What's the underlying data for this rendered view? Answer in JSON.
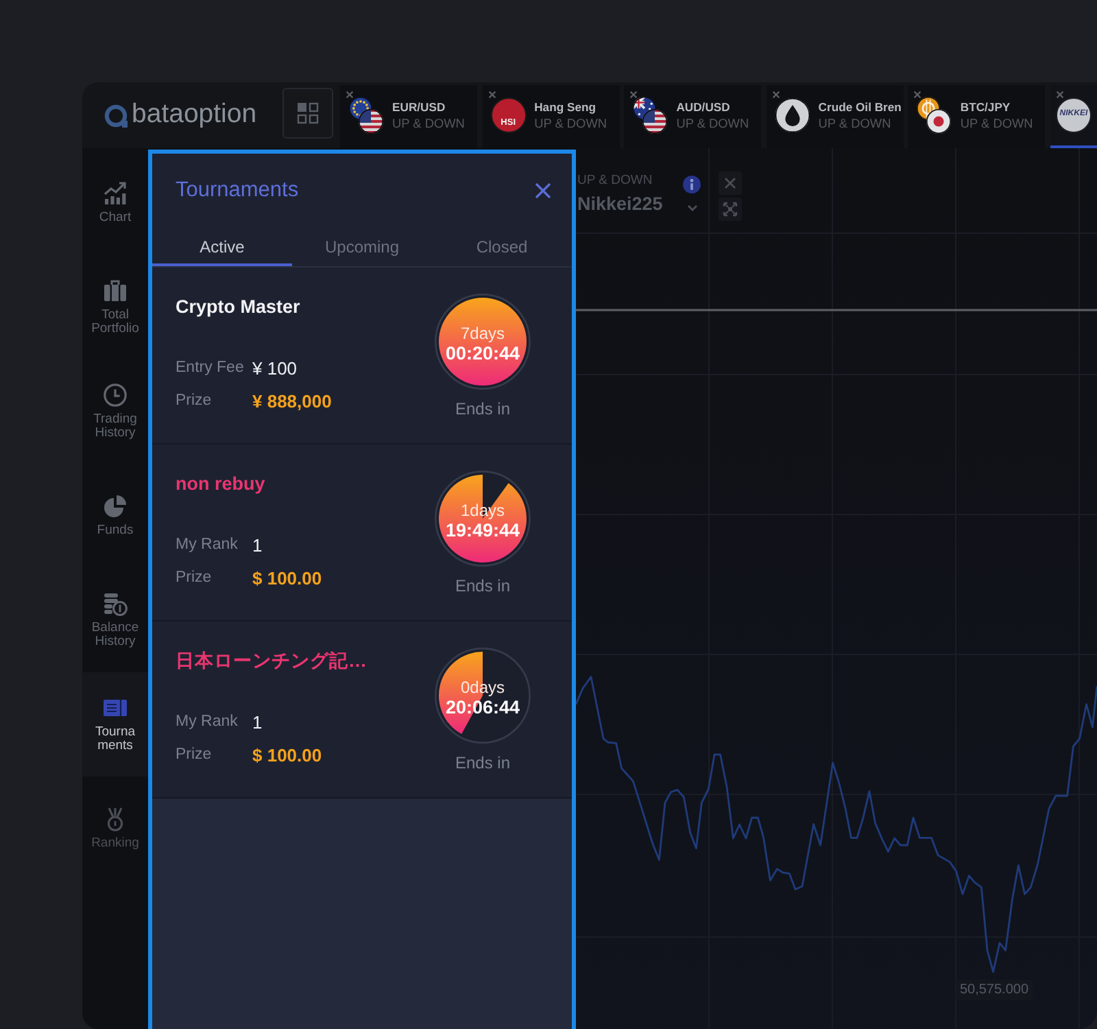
{
  "brand": {
    "name": "bataoption"
  },
  "asset_tabs": [
    {
      "name": "EUR/USD",
      "mode": "UP & DOWN",
      "selected": false
    },
    {
      "logo_text": "HSI",
      "name": "Hang Seng",
      "mode": "UP & DOWN",
      "selected": false
    },
    {
      "name": "AUD/USD",
      "mode": "UP & DOWN",
      "selected": false
    },
    {
      "name": "Crude Oil Bren",
      "mode": "UP & DOWN",
      "selected": false
    },
    {
      "name": "BTC/JPY",
      "mode": "UP & DOWN",
      "selected": false
    },
    {
      "logo_text": "NIKKEI",
      "selected": true
    }
  ],
  "sidebar": {
    "items": [
      {
        "label": "Chart",
        "selected": false,
        "disabled": false
      },
      {
        "label": "Total Portfolio",
        "selected": false,
        "disabled": false
      },
      {
        "label": "Trading History",
        "selected": false,
        "disabled": false
      },
      {
        "label": "Funds",
        "selected": false,
        "disabled": false
      },
      {
        "label": "Balance History",
        "selected": false,
        "disabled": false
      },
      {
        "label": "Tournaments",
        "selected": true,
        "disabled": false
      },
      {
        "label": "Ranking",
        "selected": false,
        "disabled": true
      }
    ]
  },
  "panel": {
    "title": "Tournaments",
    "tabs": [
      {
        "label": "Active",
        "selected": true
      },
      {
        "label": "Upcoming",
        "selected": false
      },
      {
        "label": "Closed",
        "selected": false
      }
    ],
    "tournaments": [
      {
        "title": "Crypto Master",
        "joined": false,
        "rows": [
          {
            "kind": "fee",
            "label": "Entry Fee",
            "value": "¥ 100"
          },
          {
            "kind": "prize",
            "label": "Prize",
            "value": "¥ 888,000"
          }
        ],
        "timer": {
          "days": "7days",
          "time": "00:20:44",
          "level": 1,
          "caption": "Ends in"
        }
      },
      {
        "title": "non rebuy",
        "joined": true,
        "rows": [
          {
            "kind": "rank",
            "label": "My Rank",
            "value": "1"
          },
          {
            "kind": "prize",
            "label": "Prize",
            "value": "$ 100.00"
          }
        ],
        "timer": {
          "days": "1days",
          "time": "19:49:44",
          "level": 0.9,
          "caption": "Ends in"
        }
      },
      {
        "title": "日本ローンチング記…",
        "joined": true,
        "rows": [
          {
            "kind": "rank",
            "label": "My Rank",
            "value": "1"
          },
          {
            "kind": "prize",
            "label": "Prize",
            "value": "$ 100.00"
          }
        ],
        "timer": {
          "days": "0days",
          "time": "20:06:44",
          "level": 0.42,
          "caption": "Ends in"
        }
      }
    ]
  },
  "chart": {
    "mode": "UP & DOWN",
    "asset": "Nikkei225",
    "price_label": "50,575.000"
  }
}
